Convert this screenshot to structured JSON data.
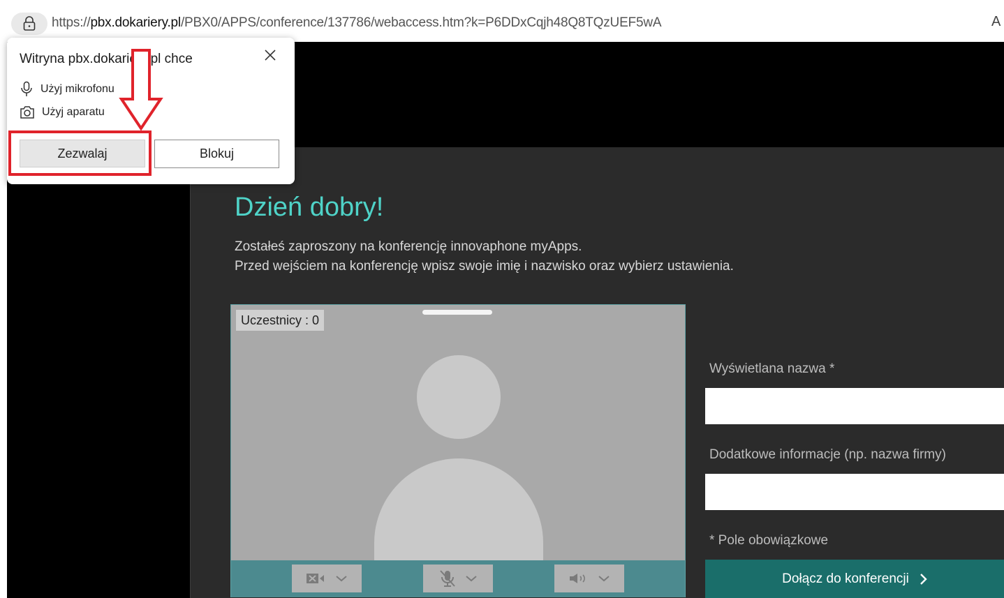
{
  "browser": {
    "url_prefix": "https://",
    "url_host": "pbx.dokariery.pl",
    "url_path": "/PBX0/APPS/conference/137786/webaccess.htm?k=P6DDxCqjh48Q8TQzUEF5wA",
    "read_aloud": "A",
    "icons": {
      "site_info": "lock-icon",
      "read_aloud": "read-aloud-icon"
    }
  },
  "permission_popup": {
    "title": "Witryna pbx.dokariery.pl chce",
    "permissions": [
      {
        "icon": "microphone-icon",
        "label": "Użyj mikrofonu"
      },
      {
        "icon": "camera-icon",
        "label": "Użyj aparatu"
      }
    ],
    "allow_label": "Zezwalaj",
    "block_label": "Blokuj",
    "close_icon": "close-icon",
    "annotation_color": "#e0232b"
  },
  "conference": {
    "greeting": "Dzień dobry!",
    "intro_line1": "Zostałeś zaproszony na konferencję innovaphone myApps.",
    "intro_line2": "Przed wejściem na konferencję wpisz swoje imię i nazwisko oraz wybierz ustawienia.",
    "participants_label": "Uczestnicy : 0",
    "controls": [
      {
        "icon": "camera-off-icon"
      },
      {
        "icon": "microphone-off-icon"
      },
      {
        "icon": "speaker-icon"
      }
    ],
    "form": {
      "display_name_label": "Wyświetlana nazwa *",
      "display_name_value": "",
      "extra_info_label": "Dodatkowe informacje (np. nazwa firmy)",
      "extra_info_value": "",
      "required_note": "* Pole obowiązkowe",
      "join_label": "Dołącz do konferencji"
    },
    "colors": {
      "accent": "#4fd3c8",
      "join_button": "#1a6e6a",
      "control_bar": "#4c8a8f"
    }
  }
}
